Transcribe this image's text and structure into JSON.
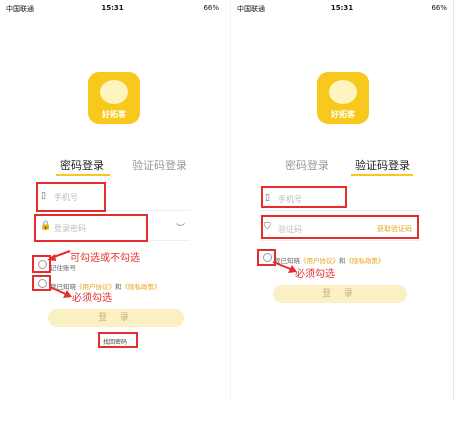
{
  "left": {
    "status": {
      "carrier": "中国联通",
      "time": "15:31",
      "battery": "66%"
    },
    "logo_text": "好拓客",
    "tabs": [
      "密码登录",
      "验证码登录"
    ],
    "phone_placeholder": "手机号",
    "password_placeholder": "登录密码",
    "remember_label": "记住账号",
    "agree_prefix": "我已知晓",
    "user_agreement": "《用户协议》",
    "and": "和",
    "privacy_policy": "《隐私政策》",
    "login_button": "登 录",
    "forgot_password": "找回密码",
    "annotation_optional": "可勾选或不勾选",
    "annotation_required": "必须勾选"
  },
  "right": {
    "status": {
      "carrier": "中国联通",
      "time": "15:31",
      "battery": "66%"
    },
    "logo_text": "好拓客",
    "tabs": [
      "密码登录",
      "验证码登录"
    ],
    "phone_placeholder": "手机号",
    "code_placeholder": "验证码",
    "send_code": "获取验证码",
    "agree_prefix": "我已知晓",
    "user_agreement": "《用户协议》",
    "and": "和",
    "privacy_policy": "《隐私政策》",
    "login_button": "登 录",
    "annotation_required": "必须勾选"
  },
  "colors": {
    "accent": "#f8c81c",
    "annotation": "#e52d2d",
    "link": "#e8a317"
  }
}
